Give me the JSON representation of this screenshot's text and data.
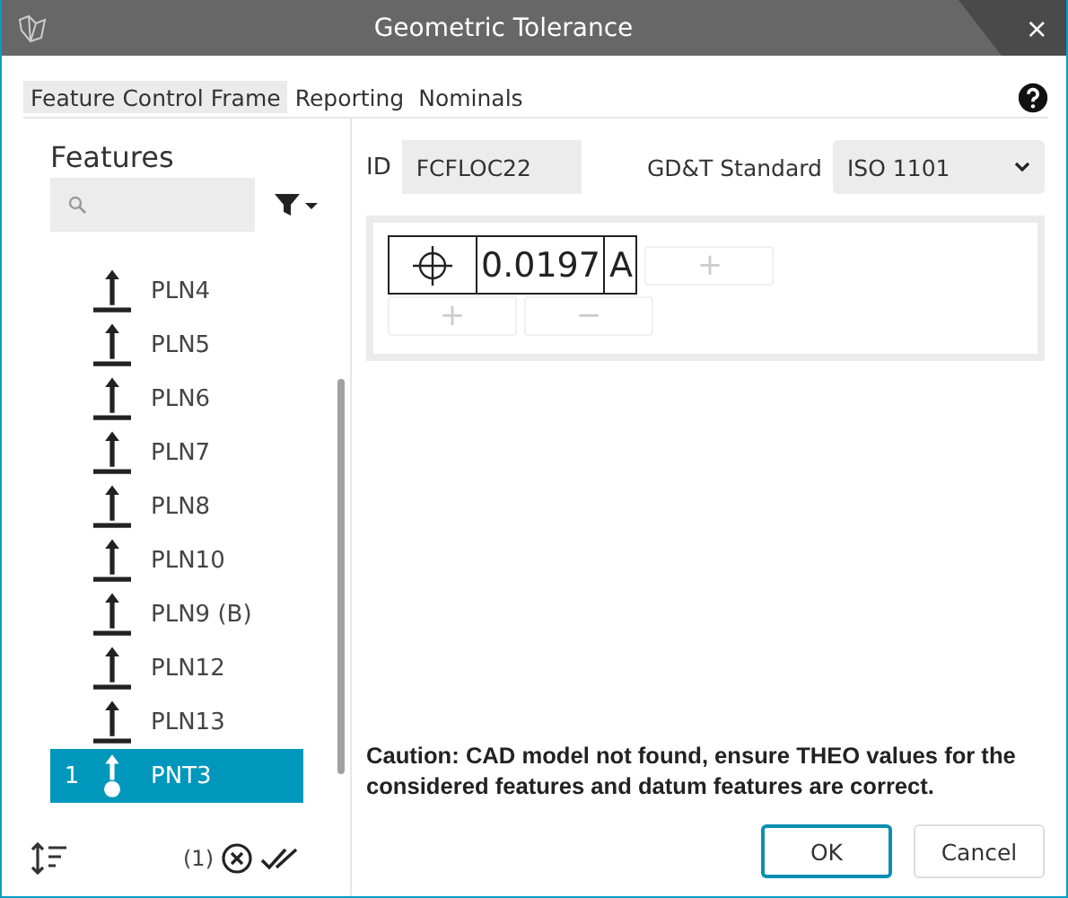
{
  "window": {
    "title": "Geometric Tolerance",
    "close": "×"
  },
  "tabs": [
    {
      "label": "Feature Control Frame",
      "selected": true
    },
    {
      "label": "Reporting",
      "selected": false
    },
    {
      "label": "Nominals",
      "selected": false
    }
  ],
  "features": {
    "title": "Features",
    "items": [
      {
        "kind": "plane",
        "label": "PLN4",
        "selected": false
      },
      {
        "kind": "plane",
        "label": "PLN5",
        "selected": false
      },
      {
        "kind": "plane",
        "label": "PLN6",
        "selected": false
      },
      {
        "kind": "plane",
        "label": "PLN7",
        "selected": false
      },
      {
        "kind": "plane",
        "label": "PLN8",
        "selected": false
      },
      {
        "kind": "plane",
        "label": "PLN10",
        "selected": false
      },
      {
        "kind": "plane",
        "label": "PLN9 (B)",
        "selected": false
      },
      {
        "kind": "plane",
        "label": "PLN12",
        "selected": false
      },
      {
        "kind": "plane",
        "label": "PLN13",
        "selected": false
      },
      {
        "kind": "point",
        "label": "PNT3",
        "selected": true,
        "order": "1"
      }
    ],
    "selection_count": "(1)"
  },
  "id": {
    "label": "ID",
    "value": "FCFLOC22"
  },
  "standard": {
    "label": "GD&T Standard",
    "value": "ISO 1101"
  },
  "frame": {
    "tolerance": "0.0197",
    "datum": "A",
    "add": "+",
    "remove": "−"
  },
  "caution": "Caution: CAD model not found, ensure THEO values for the considered features and datum features are correct.",
  "buttons": [
    {
      "label": "OK",
      "selected": true
    },
    {
      "label": "Cancel",
      "selected": false
    }
  ]
}
